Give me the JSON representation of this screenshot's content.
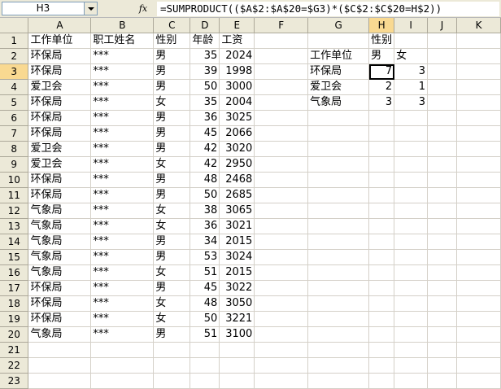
{
  "formula_bar": {
    "name_box": "H3",
    "fx_label": "fx",
    "formula": "=SUMPRODUCT(($A$2:$A$20=$G3)*($C$2:$C$20=H$2))"
  },
  "columns": [
    "A",
    "B",
    "C",
    "D",
    "E",
    "F",
    "G",
    "H",
    "I",
    "J",
    "K"
  ],
  "rows": [
    {
      "n": "1",
      "c": [
        "工作单位",
        "职工姓名",
        "性别",
        "年龄",
        "工资",
        "",
        "",
        "性别",
        "",
        "",
        ""
      ]
    },
    {
      "n": "2",
      "c": [
        "环保局",
        "***",
        "男",
        "35",
        "2024",
        "",
        "工作单位",
        "男",
        "女",
        "",
        ""
      ]
    },
    {
      "n": "3",
      "c": [
        "环保局",
        "***",
        "男",
        "39",
        "1998",
        "",
        "环保局",
        "7",
        "3",
        "",
        ""
      ]
    },
    {
      "n": "4",
      "c": [
        "爱卫会",
        "***",
        "男",
        "50",
        "3000",
        "",
        "爱卫会",
        "2",
        "1",
        "",
        ""
      ]
    },
    {
      "n": "5",
      "c": [
        "环保局",
        "***",
        "女",
        "35",
        "2004",
        "",
        "气象局",
        "3",
        "3",
        "",
        ""
      ]
    },
    {
      "n": "6",
      "c": [
        "环保局",
        "***",
        "男",
        "36",
        "3025",
        "",
        "",
        "",
        "",
        "",
        ""
      ]
    },
    {
      "n": "7",
      "c": [
        "环保局",
        "***",
        "男",
        "45",
        "2066",
        "",
        "",
        "",
        "",
        "",
        ""
      ]
    },
    {
      "n": "8",
      "c": [
        "爱卫会",
        "***",
        "男",
        "42",
        "3020",
        "",
        "",
        "",
        "",
        "",
        ""
      ]
    },
    {
      "n": "9",
      "c": [
        "爱卫会",
        "***",
        "女",
        "42",
        "2950",
        "",
        "",
        "",
        "",
        "",
        ""
      ]
    },
    {
      "n": "10",
      "c": [
        "环保局",
        "***",
        "男",
        "48",
        "2468",
        "",
        "",
        "",
        "",
        "",
        ""
      ]
    },
    {
      "n": "11",
      "c": [
        "环保局",
        "***",
        "男",
        "50",
        "2685",
        "",
        "",
        "",
        "",
        "",
        ""
      ]
    },
    {
      "n": "12",
      "c": [
        "气象局",
        "***",
        "女",
        "38",
        "3065",
        "",
        "",
        "",
        "",
        "",
        ""
      ]
    },
    {
      "n": "13",
      "c": [
        "气象局",
        "***",
        "女",
        "36",
        "3021",
        "",
        "",
        "",
        "",
        "",
        ""
      ]
    },
    {
      "n": "14",
      "c": [
        "气象局",
        "***",
        "男",
        "34",
        "2015",
        "",
        "",
        "",
        "",
        "",
        ""
      ]
    },
    {
      "n": "15",
      "c": [
        "气象局",
        "***",
        "男",
        "53",
        "3024",
        "",
        "",
        "",
        "",
        "",
        ""
      ]
    },
    {
      "n": "16",
      "c": [
        "气象局",
        "***",
        "女",
        "51",
        "2015",
        "",
        "",
        "",
        "",
        "",
        ""
      ]
    },
    {
      "n": "17",
      "c": [
        "环保局",
        "***",
        "男",
        "45",
        "3022",
        "",
        "",
        "",
        "",
        "",
        ""
      ]
    },
    {
      "n": "18",
      "c": [
        "环保局",
        "***",
        "女",
        "48",
        "3050",
        "",
        "",
        "",
        "",
        "",
        ""
      ]
    },
    {
      "n": "19",
      "c": [
        "环保局",
        "***",
        "女",
        "50",
        "3221",
        "",
        "",
        "",
        "",
        "",
        ""
      ]
    },
    {
      "n": "20",
      "c": [
        "气象局",
        "***",
        "男",
        "51",
        "3100",
        "",
        "",
        "",
        "",
        "",
        ""
      ]
    },
    {
      "n": "21",
      "c": [
        "",
        "",
        "",
        "",
        "",
        "",
        "",
        "",
        "",
        "",
        ""
      ]
    },
    {
      "n": "22",
      "c": [
        "",
        "",
        "",
        "",
        "",
        "",
        "",
        "",
        "",
        "",
        ""
      ]
    },
    {
      "n": "23",
      "c": [
        "",
        "",
        "",
        "",
        "",
        "",
        "",
        "",
        "",
        "",
        ""
      ]
    }
  ],
  "active_cell": {
    "row": "3",
    "col": "H"
  },
  "colors": {
    "header_bg": "#ece9d8",
    "selected_header": "#f9d991",
    "gridline": "#d4d0c8"
  }
}
